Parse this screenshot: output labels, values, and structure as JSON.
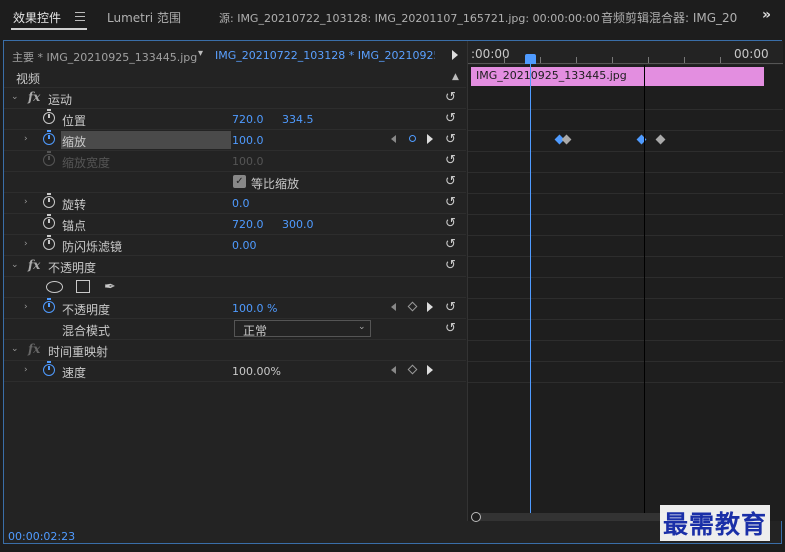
{
  "tabs": [
    {
      "label": "效果控件",
      "active": true
    },
    {
      "label": "Lumetri 范围"
    },
    {
      "label": "源: IMG_20210722_103128: IMG_20201107_165721.jpg: 00:00:00:00"
    },
    {
      "label": "音频剪辑混合器: IMG_20"
    }
  ],
  "overflow": "»",
  "clip_header": {
    "master": "主要 * IMG_20210925_133445.jpg",
    "sequence": "IMG_20210722_103128 * IMG_20210925_..."
  },
  "sections": {
    "video": "视频",
    "motion": "运动",
    "opacity": "不透明度",
    "time_remap": "时间重映射"
  },
  "properties": {
    "position": {
      "label": "位置",
      "x": "720.0",
      "y": "334.5"
    },
    "scale": {
      "label": "缩放",
      "value": "100.0"
    },
    "scale_width": {
      "label": "缩放宽度",
      "value": "100.0"
    },
    "uniform_scale": {
      "label": "等比缩放",
      "checked": true
    },
    "rotation": {
      "label": "旋转",
      "value": "0.0"
    },
    "anchor": {
      "label": "锚点",
      "x": "720.0",
      "y": "300.0"
    },
    "flicker": {
      "label": "防闪烁滤镜",
      "value": "0.00"
    },
    "opacity": {
      "label": "不透明度",
      "value": "100.0 %"
    },
    "blend_mode": {
      "label": "混合模式",
      "value": "正常"
    },
    "speed": {
      "label": "速度",
      "value": "100.00%"
    }
  },
  "timeline": {
    "tc_left": ":00:00",
    "tc_right": "00:00",
    "clip_name": "IMG_20210925_133445.jpg"
  },
  "footer_timecode": "00:00:02:23",
  "watermark": "最需教育",
  "colors": {
    "accent": "#4f9bff",
    "clip": "#e38ee0",
    "panel_border": "#3a6ea8"
  }
}
